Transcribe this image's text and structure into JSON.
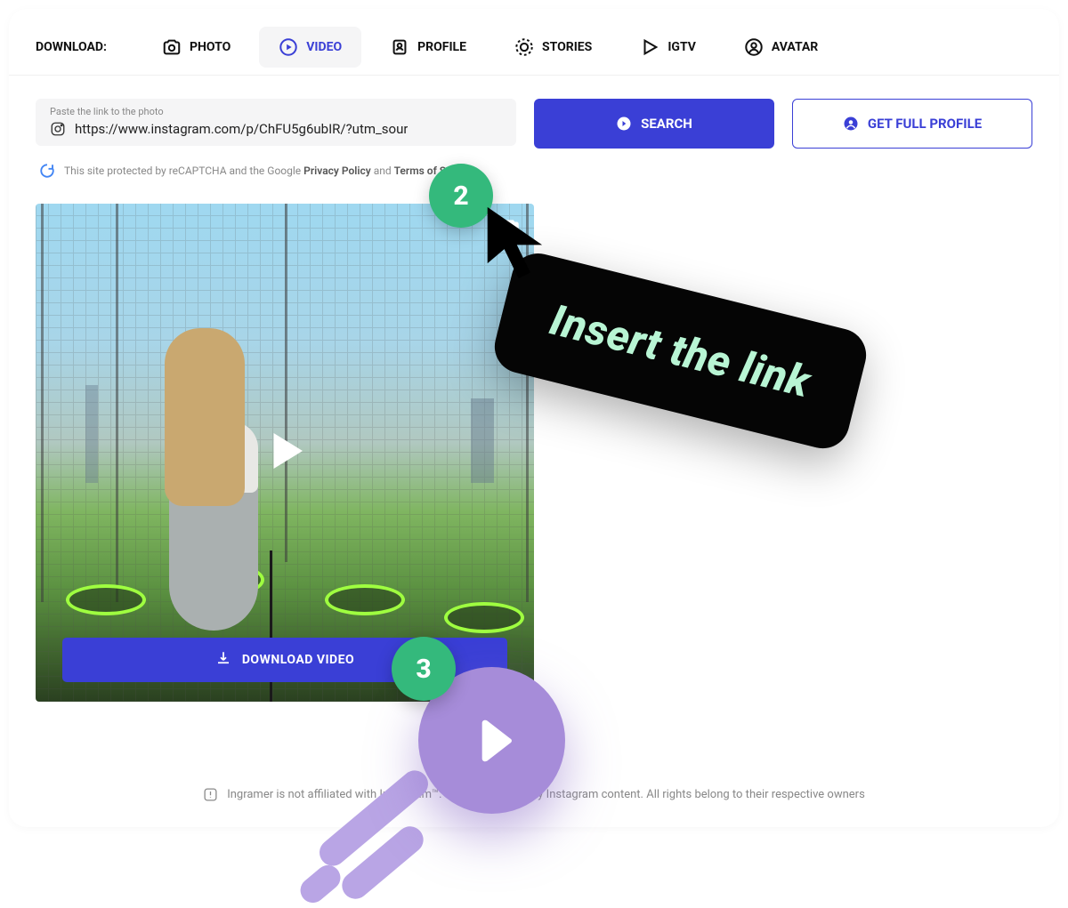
{
  "nav": {
    "label": "DOWNLOAD:",
    "tabs": {
      "photo": "PHOTO",
      "video": "VIDEO",
      "profile": "PROFILE",
      "stories": "STORIES",
      "igtv": "IGTV",
      "avatar": "AVATAR"
    },
    "active": "video"
  },
  "search": {
    "placeholder": "Paste the link to the photo",
    "value": "https://www.instagram.com/p/ChFU5g6ubIR/?utm_sour",
    "search_label": "SEARCH",
    "profile_label": "GET FULL PROFILE"
  },
  "recaptcha": {
    "text_prefix": "This site protected by reCAPTCHA and the Google ",
    "privacy": "Privacy Policy",
    "and": " and ",
    "terms": "Terms of Service"
  },
  "download_label": "DOWNLOAD VIDEO",
  "steps": {
    "two": "2",
    "three": "3"
  },
  "callout": "Insert the link",
  "disclaimer": "Ingramer is not affiliated with Instagram™. We do not host any Instagram content. All rights belong to their respective owners",
  "colors": {
    "primary": "#3a3fd6",
    "accent_green": "#34b97c",
    "accent_mint": "#b8f5d4",
    "purple": "#a68cd9"
  }
}
